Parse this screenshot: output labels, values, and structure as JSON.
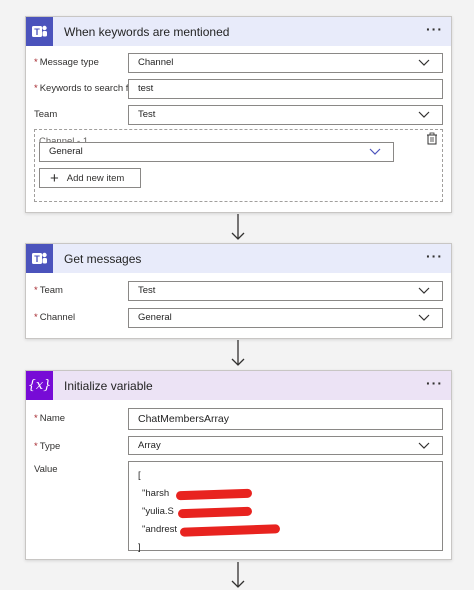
{
  "card1": {
    "title": "When keywords are mentioned",
    "more_label": "···",
    "message_type_label": "Message type",
    "message_type_value": "Channel",
    "keywords_label": "Keywords to search for",
    "keywords_value": "test",
    "team_label": "Team",
    "team_value": "Test",
    "channel_group_label": "Channel - 1",
    "channel_value": "General",
    "add_new_item": "Add new item"
  },
  "card2": {
    "title": "Get messages",
    "more_label": "···",
    "team_label": "Team",
    "team_value": "Test",
    "channel_label": "Channel",
    "channel_value": "General"
  },
  "card3": {
    "title": "Initialize variable",
    "more_label": "···",
    "icon_text": "{x}",
    "name_label": "Name",
    "name_value": "ChatMembersArray",
    "type_label": "Type",
    "type_value": "Array",
    "value_label": "Value",
    "value_lines": [
      "[",
      "\"harsh",
      "\"yulia.S",
      "\"andrest",
      "]"
    ]
  },
  "required_marker": "*",
  "colors": {
    "teams_icon": "#4b53bc",
    "variable_icon": "#770bd6",
    "teams_header": "#e8ebfa",
    "variable_header": "#ece3f5",
    "redaction": "#e8231f"
  },
  "icons": [
    "teams-icon",
    "variable-icon",
    "chevron-down-icon",
    "more-icon",
    "delete-icon",
    "plus-icon",
    "arrow-down-icon"
  ]
}
